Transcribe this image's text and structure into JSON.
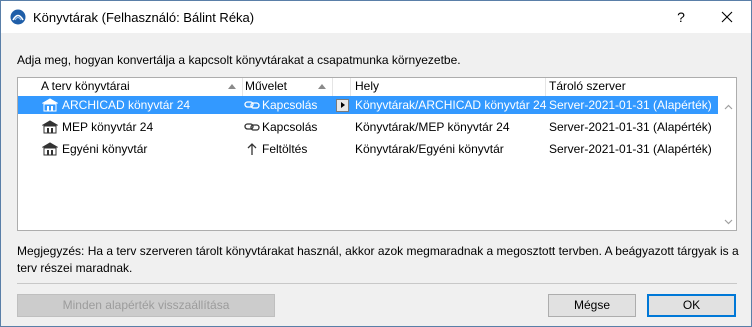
{
  "window": {
    "title": "Könyvtárak (Felhasználó: Bálint Réka)",
    "help_label": "?"
  },
  "instruction": "Adja meg, hogyan konvertálja a kapcsolt könyvtárakat a csapatmunka környezetbe.",
  "table": {
    "columns": [
      "A terv könyvtárai",
      "Művelet",
      "Hely",
      "Tároló szerver"
    ],
    "rows": [
      {
        "name": "ARCHICAD könyvtár 24",
        "action": "Kapcsolás",
        "location": "Könyvtárak/ARCHICAD könyvtár 24",
        "server": "Server-2021-01-31 (Alapérték)",
        "selected": true
      },
      {
        "name": "MEP könyvtár 24",
        "action": "Kapcsolás",
        "location": "Könyvtárak/MEP könyvtár 24",
        "server": "Server-2021-01-31 (Alapérték)",
        "selected": false
      },
      {
        "name": "Egyéni könyvtár",
        "action": "Feltöltés",
        "location": "Könyvtárak/Egyéni könyvtár",
        "server": "Server-2021-01-31 (Alapérték)",
        "selected": false
      }
    ]
  },
  "note": "Megjegyzés: Ha a terv szerveren tárolt könyvtárakat használ, akkor azok megmaradnak a megosztott tervben. A beágyazott tárgyak is a terv részei maradnak.",
  "buttons": {
    "reset_all": "Minden alapérték visszaállítása",
    "cancel": "Mégse",
    "ok": "OK"
  },
  "colors": {
    "selection": "#3399ff",
    "accent": "#0078d7"
  },
  "icons": {
    "app": "archicad-logo-icon",
    "library": "library-building-icon",
    "link": "link-chain-icon",
    "upload": "arrow-up-icon"
  }
}
